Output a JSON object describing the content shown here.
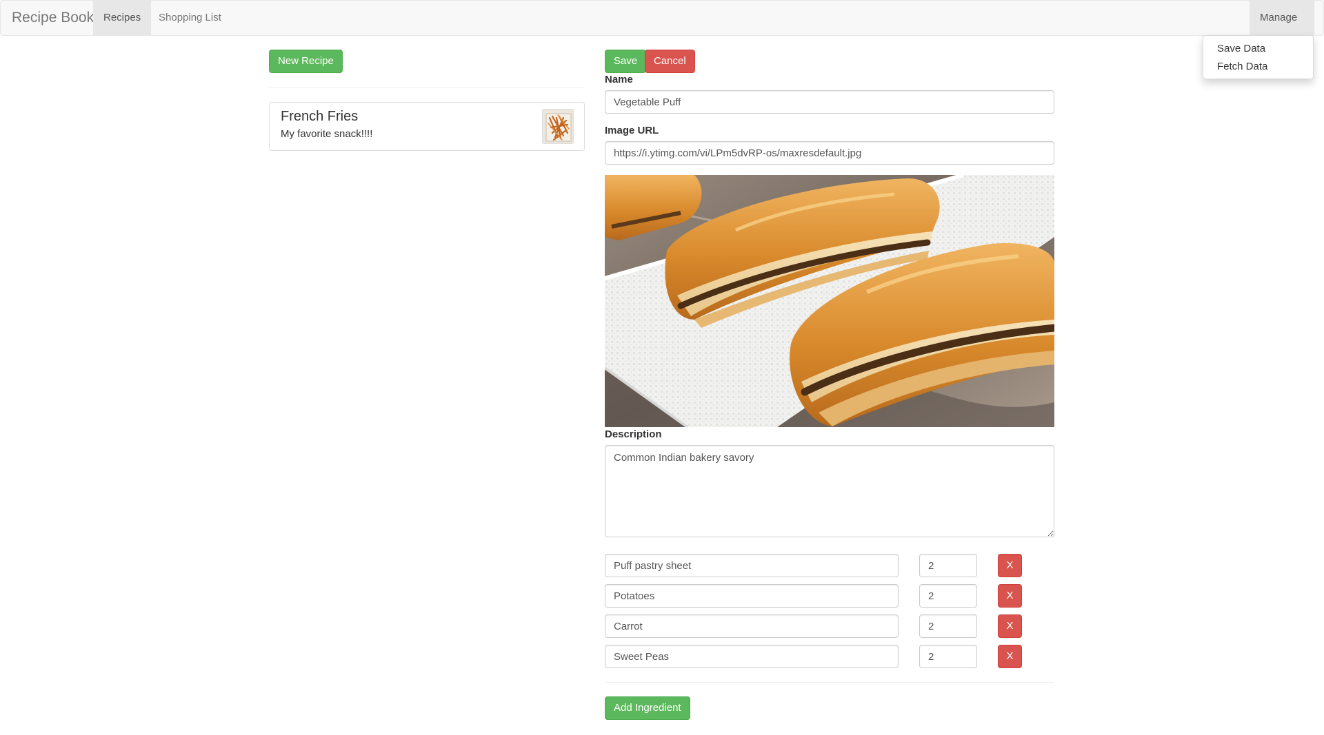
{
  "navbar": {
    "brand": "Recipe Book",
    "links": [
      {
        "label": "Recipes",
        "active": true
      },
      {
        "label": "Shopping List",
        "active": false
      }
    ],
    "manage_label": "Manage",
    "manage_menu": [
      "Save Data",
      "Fetch Data"
    ]
  },
  "recipe_list": {
    "new_button": "New Recipe",
    "items": [
      {
        "name": "French Fries",
        "description": "My favorite snack!!!!"
      }
    ]
  },
  "editor": {
    "save_label": "Save",
    "cancel_label": "Cancel",
    "name_label": "Name",
    "name_value": "Vegetable Puff",
    "image_label": "Image URL",
    "image_value": "https://i.ytimg.com/vi/LPm5dvRP-os/maxresdefault.jpg",
    "description_label": "Description",
    "description_value": "Common Indian bakery savory",
    "ingredients": [
      {
        "name": "Puff pastry sheet",
        "amount": "2",
        "remove": "X"
      },
      {
        "name": "Potatoes",
        "amount": "2",
        "remove": "X"
      },
      {
        "name": "Carrot",
        "amount": "2",
        "remove": "X"
      },
      {
        "name": "Sweet Peas",
        "amount": "2",
        "remove": "X"
      }
    ],
    "add_ingredient_label": "Add Ingredient"
  },
  "colors": {
    "success": "#5cb85c",
    "danger": "#d9534f",
    "navbar_bg": "#f8f8f8"
  }
}
